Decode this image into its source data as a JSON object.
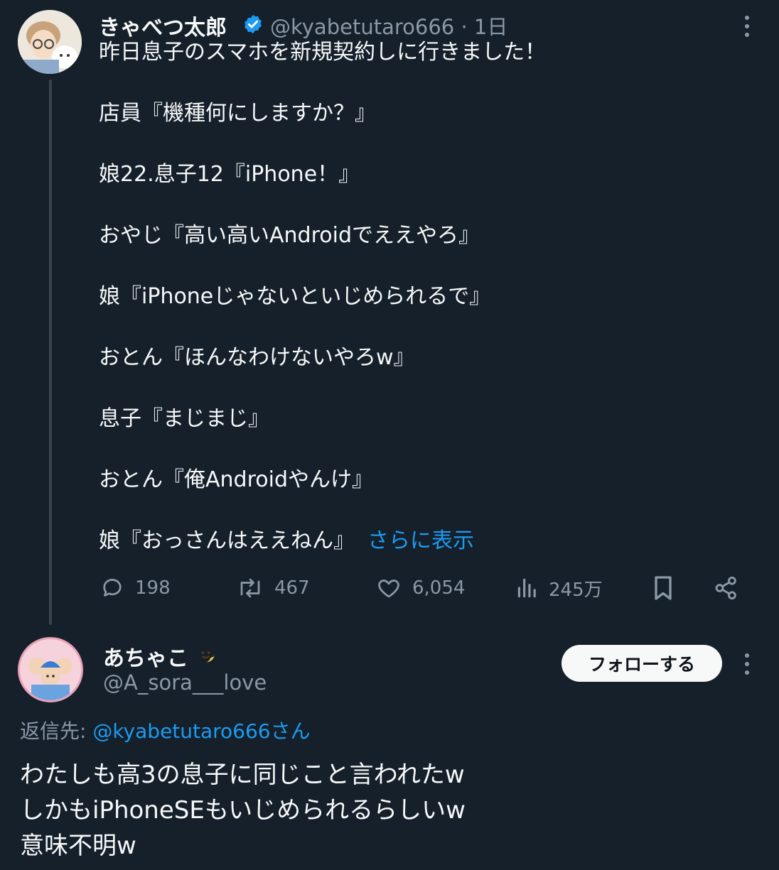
{
  "tweet": {
    "author_name": "きゃべつ太郎",
    "handle": "@kyabetutaro666",
    "separator": "·",
    "time": "1日",
    "lines": [
      "昨日息子のスマホを新規契約しに行きました！",
      "店員『機種何にしますか？』",
      "娘22.息子12『iPhone！』",
      "おやじ『高い高いAndroidでええやろ』",
      "娘『iPhoneじゃないといじめられるで』",
      "おとん『ほんなわけないやろw』",
      "息子『まじまじ』",
      "おとん『俺Androidやんけ』",
      "娘『おっさんはええねん』"
    ],
    "show_more": "さらに表示",
    "stats": {
      "replies": "198",
      "retweets": "467",
      "likes": "6,054",
      "views": "245万"
    }
  },
  "reply": {
    "author_name": "あちゃこ",
    "handle": "@A_sora___love",
    "follow_label": "フォローする",
    "reply_to_label": "返信先:",
    "reply_to_handle": "@kyabetutaro666さん",
    "lines": [
      "わたしも高3の息子に同じこと言われたw",
      "しかもiPhoneSEもいじめられるらしいw",
      "意味不明w"
    ]
  },
  "colors": {
    "background": "#15202b",
    "text": "#f7f9f9",
    "secondary": "#8b98a5",
    "accent": "#1d9bf0",
    "verified": "#1d9bf0"
  },
  "icons": [
    "verified-badge-icon",
    "more-icon",
    "reply-icon",
    "retweet-icon",
    "like-icon",
    "views-icon",
    "bookmark-icon",
    "share-icon",
    "emoji-icon"
  ]
}
